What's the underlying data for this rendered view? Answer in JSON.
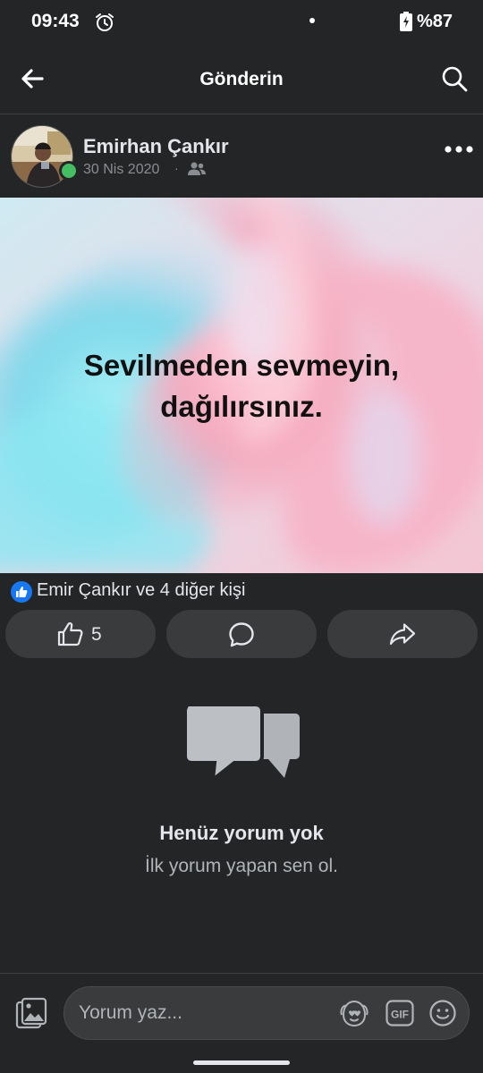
{
  "status_bar": {
    "time": "09:43",
    "battery": "%87",
    "icons": [
      "alarm-icon",
      "notification-dot",
      "battery-charging-icon"
    ]
  },
  "nav": {
    "title": "Gönderin",
    "back_icon": "arrow-left-icon",
    "search_icon": "search-icon"
  },
  "post": {
    "author": "Emirhan Çankır",
    "date": "30 Nis 2020",
    "separator": "·",
    "audience_icon": "friends-icon",
    "image_text": [
      "Sevilmeden sevmeyin,",
      "dağılırsınız."
    ],
    "reactions_text": "Emir Çankır ve 4 diğer kişi",
    "like_count": "5"
  },
  "comments": {
    "empty_title": "Henüz yorum yok",
    "empty_subtitle": "İlk yorum yapan sen ol."
  },
  "composer": {
    "placeholder": "Yorum yaz..."
  },
  "colors": {
    "background": "#242526",
    "button": "#3a3b3c",
    "online": "#45bd62",
    "like_blue": "#1877f2"
  }
}
